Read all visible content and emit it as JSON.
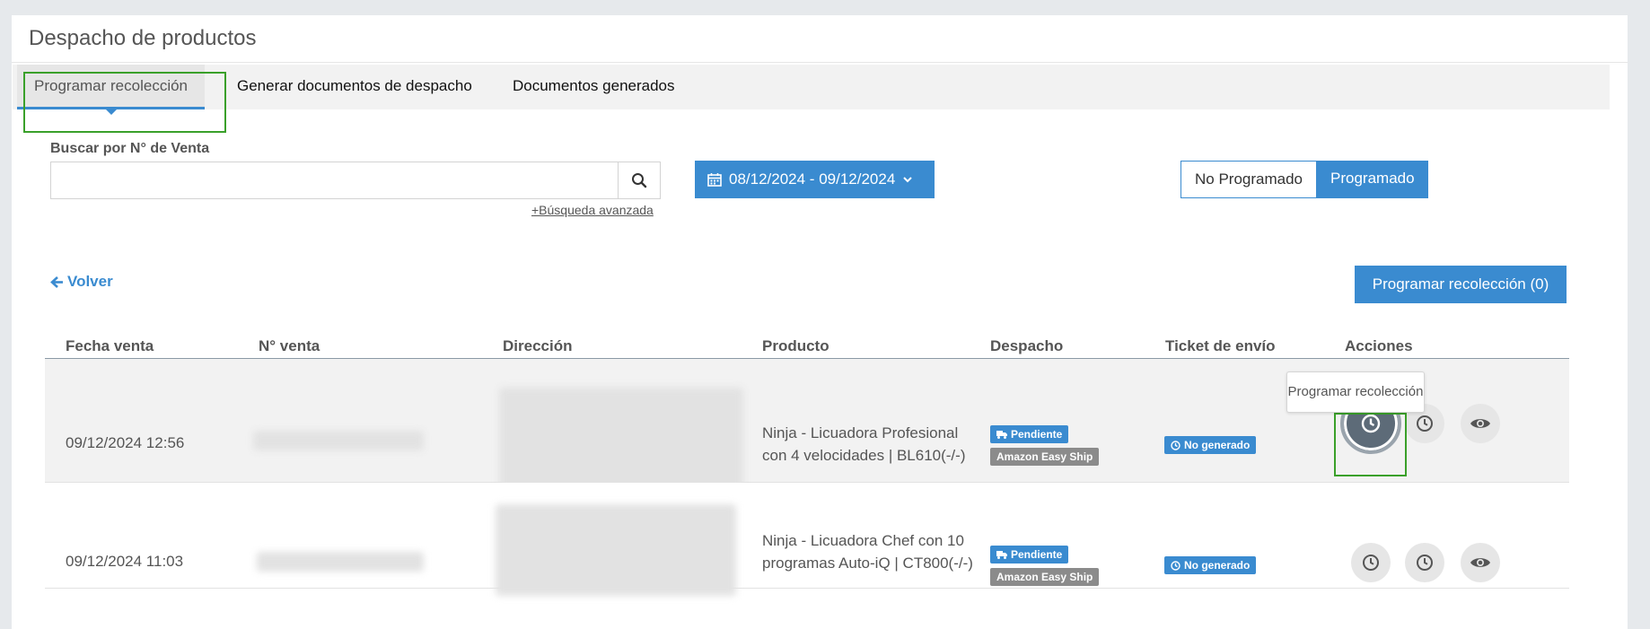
{
  "panel": {
    "title": "Despacho de productos"
  },
  "tabs": [
    {
      "label": "Programar recolección"
    },
    {
      "label": "Generar documentos de despacho"
    },
    {
      "label": "Documentos generados"
    }
  ],
  "search": {
    "label": "Buscar por N° de Venta",
    "value": "",
    "placeholder": "",
    "advanced_link": "+Búsqueda avanzada",
    "icon": "search-icon"
  },
  "date_range": {
    "label": "08/12/2024 - 09/12/2024",
    "icon": "calendar-icon"
  },
  "toggle": {
    "off_label": "No Programado",
    "on_label": "Programado",
    "selected": "Programado"
  },
  "back_label": "Volver",
  "schedule_button": "Programar recolección (0)",
  "table": {
    "headers": [
      "Fecha venta",
      "N° venta",
      "Dirección",
      "Producto",
      "Despacho",
      "Ticket de envío",
      "Acciones"
    ],
    "rows": [
      {
        "fecha": "09/12/2024 12:56",
        "producto": "Ninja - Licuadora Profesional con 4 velocidades | BL610(-/-)",
        "despacho_status": "Pendiente",
        "despacho_carrier": "Amazon Easy Ship",
        "ticket": "No generado"
      },
      {
        "fecha": "09/12/2024 11:03",
        "producto": "Ninja - Licuadora Chef con 10 programas Auto-iQ | CT800(-/-)",
        "despacho_status": "Pendiente",
        "despacho_carrier": "Amazon Easy Ship",
        "ticket": "No generado"
      }
    ]
  },
  "tooltip": "Programar recolección",
  "colors": {
    "accent": "#3a8bd0",
    "highlight": "#3aa02a",
    "badge_gray": "#8b8b8b"
  }
}
